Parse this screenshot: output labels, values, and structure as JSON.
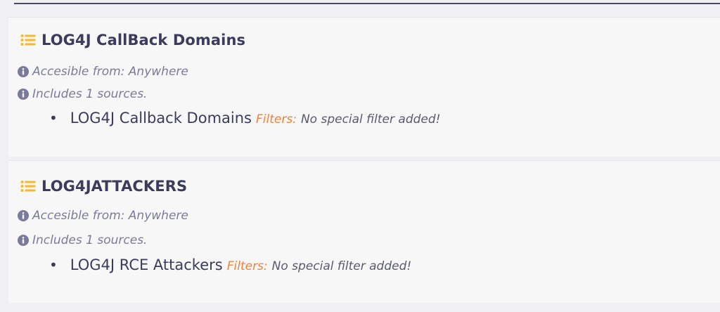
{
  "colors": {
    "title": "#3b3b5c",
    "meta": "#7b7b99",
    "filters_label": "#f0823c",
    "list_icon": "#f5b82e"
  },
  "feeds": [
    {
      "title": "LOG4J CallBack Domains",
      "accessible": "Accesible from: Anywhere",
      "includes": "Includes 1 sources.",
      "sources": [
        {
          "name": "LOG4J Callback Domains",
          "filters_label": "Filters:",
          "filters_value": "No special filter added!"
        }
      ]
    },
    {
      "title": "LOG4JATTACKERS",
      "accessible": "Accesible from: Anywhere",
      "includes": "Includes 1 sources.",
      "sources": [
        {
          "name": "LOG4J RCE Attackers",
          "filters_label": "Filters:",
          "filters_value": "No special filter added!"
        }
      ]
    }
  ]
}
